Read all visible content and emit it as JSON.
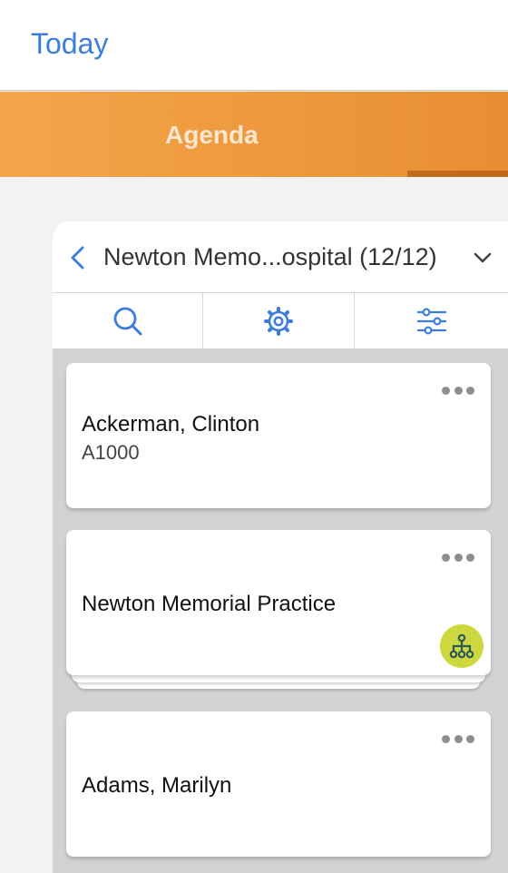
{
  "header": {
    "today_label": "Today"
  },
  "tabs": {
    "agenda_label": "Agenda"
  },
  "panel": {
    "context_title": "Newton Memo...ospital (12/12)",
    "toolbar": [
      "search-icon",
      "gear-icon",
      "sliders-icon"
    ],
    "cards": [
      {
        "name": "Ackerman, Clinton",
        "id": "A1000"
      },
      {
        "name": "Newton Memorial Practice",
        "badge": "org-hierarchy-icon"
      },
      {
        "name": "Adams, Marilyn"
      }
    ]
  },
  "colors": {
    "accent_blue": "#3b7ddd",
    "tab_orange": "#ee983c",
    "tab_indicator": "#c2691b",
    "badge_green": "#cdd83f"
  }
}
